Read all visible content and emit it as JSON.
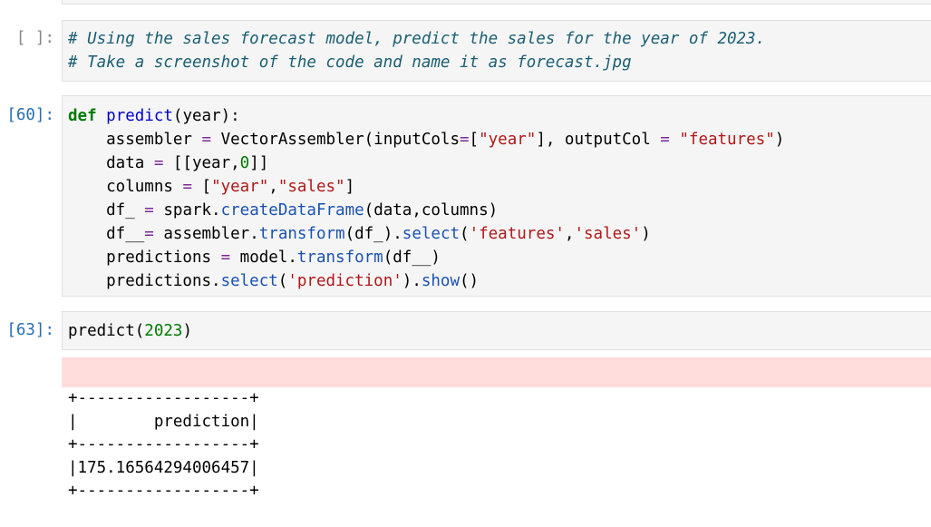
{
  "cells": {
    "comment_cell": {
      "prompt": "[ ]:",
      "lines": [
        "# Using the sales forecast model, predict the sales for the year of 2023.",
        "# Take a screenshot of the code and name it as forecast.jpg"
      ]
    },
    "predict_def_cell": {
      "prompt": "[60]:",
      "code_text": "def predict(year):\n    assembler = VectorAssembler(inputCols=[\"year\"], outputCol = \"features\")\n    data = [[year,0]]\n    columns = [\"year\",\"sales\"]\n    df_ = spark.createDataFrame(data,columns)\n    df__= assembler.transform(df_).select('features','sales')\n    predictions = model.transform(df__)\n    predictions.select('prediction').show()"
    },
    "call_cell": {
      "prompt": "[63]:",
      "code_text": "predict(2023)"
    }
  },
  "output": {
    "table_border": "+------------------+",
    "header_row": "|        prediction|",
    "value_row": "|175.16564294006457|"
  }
}
